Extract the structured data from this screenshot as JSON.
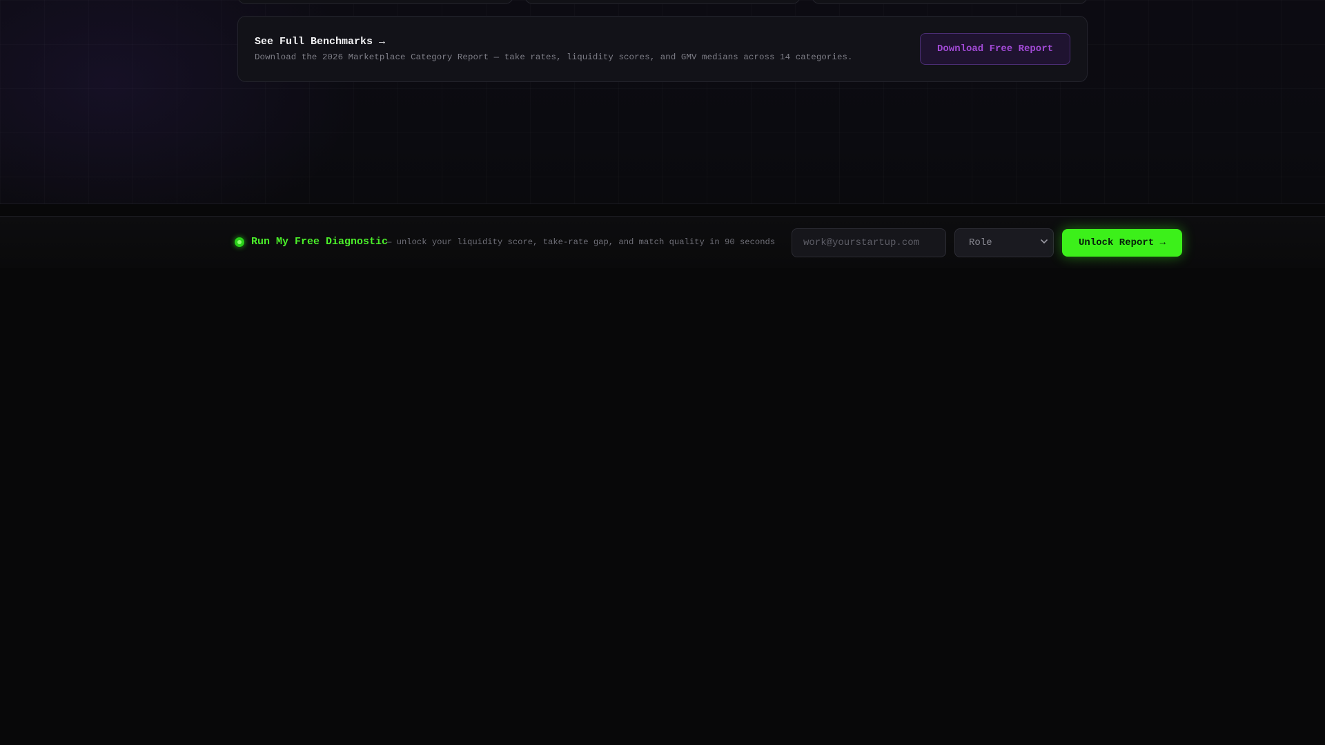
{
  "benchmarks": {
    "title": "See Full Benchmarks →",
    "description": "Download the 2026 Marketplace Category Report — take rates, liquidity scores, and GMV medians across 14 categories.",
    "button_label": "Download Free Report"
  },
  "diagnostic_bar": {
    "title": "Run My Free Diagnostic",
    "subtitle": "— unlock your liquidity score, take-rate gap, and match quality in 90 seconds",
    "email_placeholder": "work@yourstartup.com",
    "email_value": "",
    "role_selected": "Role",
    "role_options": [
      "Role"
    ],
    "button_label": "Unlock Report →"
  },
  "icons": {
    "status": "status-dot-icon",
    "select": "chevron-down-icon"
  },
  "colors": {
    "accent_green": "#3cf01a",
    "accent_purple": "#a24ad6",
    "background": "#080809"
  }
}
